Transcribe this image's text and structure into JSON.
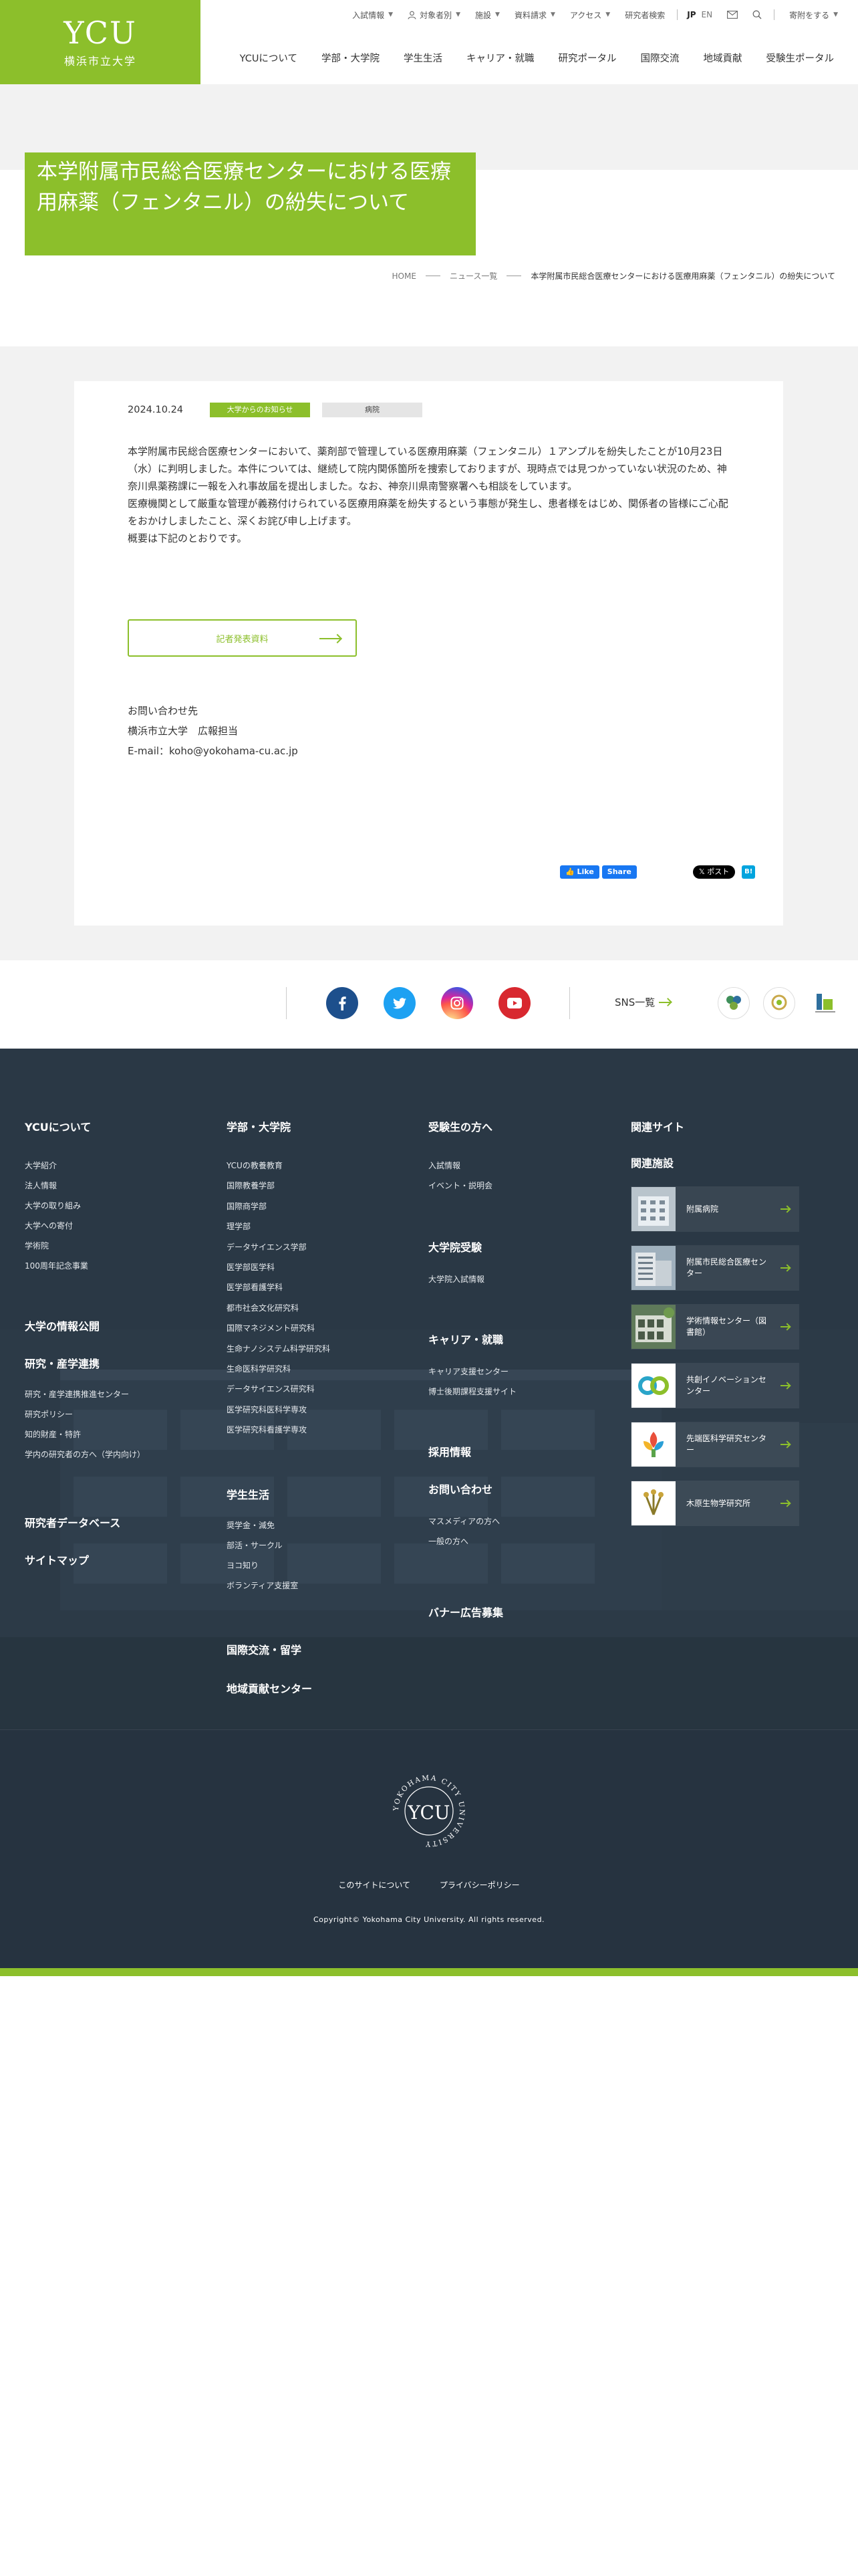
{
  "header": {
    "logo_en": "YCU",
    "logo_jp": "横浜市立大学",
    "util": {
      "nyushi": "入試情報",
      "taisho": "対象者別",
      "shisetsu": "施設",
      "shiryo": "資料請求",
      "access": "アクセス",
      "kenkyusha": "研究者検索",
      "lang_jp": "JP",
      "lang_en": "EN",
      "support": "寄附をする"
    },
    "nav": [
      "YCUについて",
      "学部・大学院",
      "学生生活",
      "キャリア・就職",
      "研究ポータル",
      "国際交流",
      "地域貢献",
      "受験生ポータル"
    ]
  },
  "page": {
    "title": "本学附属市民総合医療センターにおける医療用麻薬（フェンタニル）の紛失について",
    "breadcrumb": {
      "home": "HOME",
      "news": "ニュース一覧",
      "current": "本学附属市民総合医療センターにおける医療用麻薬（フェンタニル）の紛失について"
    }
  },
  "article": {
    "date": "2024.10.24",
    "tag_primary": "大学からのお知らせ",
    "tag_secondary": "病院",
    "paragraphs": [
      "本学附属市民総合医療センターにおいて、薬剤部で管理している医療用麻薬（フェンタニル）１アンプルを紛失したことが10月23日（水）に判明しました。本件については、継続して院内関係箇所を捜索しておりますが、現時点では見つかっていない状況のため、神奈川県薬務課に一報を入れ事故届を提出しました。なお、神奈川県南警察署へも相談をしています。",
      "医療機関として厳重な管理が義務付けられている医療用麻薬を紛失するという事態が発生し、患者様をはじめ、関係者の皆様にご心配をおかけしましたこと、深くお詫び申し上げます。",
      "概要は下記のとおりです。"
    ],
    "press_button": "記者発表資料",
    "contact": {
      "heading": "お問い合わせ先",
      "org": "横浜市立大学　広報担当",
      "email": "E-mail：koho@yokohama-cu.ac.jp"
    },
    "share": {
      "fb_like": "Like",
      "fb_share": "Share",
      "x_post": "ポスト",
      "hatena": "B!"
    }
  },
  "sns": {
    "list_label": "SNS一覧",
    "icons": [
      "facebook-icon",
      "twitter-icon",
      "instagram-icon",
      "youtube-icon"
    ],
    "colors": {
      "facebook": "#1d4f8c",
      "twitter": "#1da1f2",
      "youtube": "#d8282f"
    }
  },
  "footer": {
    "col1": {
      "heading": "YCUについて",
      "links": [
        "大学紹介",
        "法人情報",
        "大学の取り組み",
        "大学への寄付",
        "学術院",
        "100周年記念事業"
      ],
      "h2": "大学の情報公開",
      "h3": "研究・産学連携",
      "links3": [
        "研究・産学連携推進センター",
        "研究ポリシー",
        "知的財産・特許",
        "学内の研究者の方へ（学内向け）"
      ],
      "h4": "研究者データベース",
      "h5": "サイトマップ"
    },
    "col2": {
      "heading": "学部・大学院",
      "links": [
        "YCUの教養教育",
        "国際教養学部",
        "国際商学部",
        "理学部",
        "データサイエンス学部",
        "医学部医学科",
        "医学部看護学科",
        "都市社会文化研究科",
        "国際マネジメント研究科",
        "生命ナノシステム科学研究科",
        "生命医科学研究科",
        "データサイエンス研究科",
        "医学研究科医科学専攻",
        "医学研究科看護学専攻"
      ],
      "h2": "学生生活",
      "links2": [
        "奨学金・減免",
        "部活・サークル",
        "ヨコ知り",
        "ボランティア支援室"
      ],
      "h3": "国際交流・留学",
      "h4": "地域貢献センター"
    },
    "col3": {
      "heading": "受験生の方へ",
      "links": [
        "入試情報",
        "イベント・説明会"
      ],
      "h2": "大学院受験",
      "links2": [
        "大学院入試情報"
      ],
      "h3": "キャリア・就職",
      "links3": [
        "キャリア支援センター",
        "博士後期課程支援サイト"
      ],
      "h4": "採用情報",
      "h5": "お問い合わせ",
      "links5": [
        "マスメディアの方へ",
        "一般の方へ"
      ],
      "h6": "バナー広告募集"
    },
    "col4": {
      "heading": "関連サイト",
      "h2": "関連施設",
      "items": [
        "附属病院",
        "附属市民総合医療センター",
        "学術情報センター（図書館）",
        "共創イノベーションセンター",
        "先端医科学研究センター",
        "木原生物学研究所"
      ]
    },
    "emblem_text": "YOKOHAMA CITY UNIVERSITY",
    "emblem_mark": "YCU",
    "links": [
      "このサイトについて",
      "プライバシーポリシー"
    ],
    "copyright": "Copyright© Yokohama City University. All rights reserved."
  }
}
